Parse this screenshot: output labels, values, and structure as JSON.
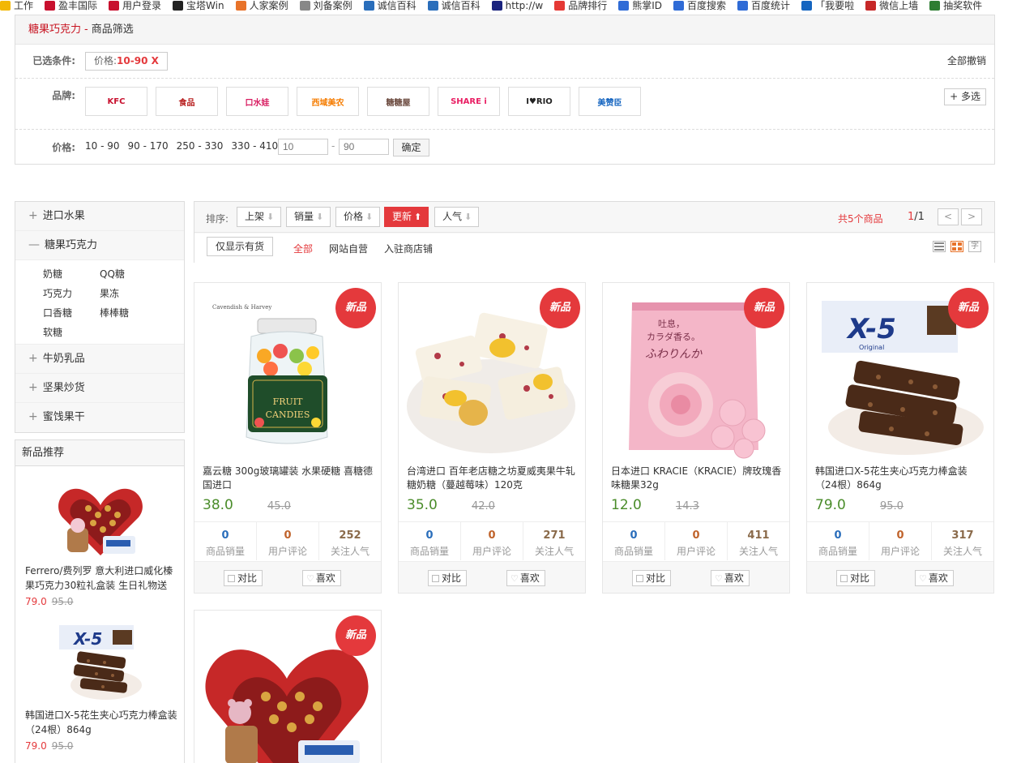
{
  "bookmarks": [
    {
      "label": "工作",
      "icon": "folder-icon",
      "color": "#f2b705"
    },
    {
      "label": "盈丰国际",
      "icon": "kfc-icon",
      "color": "#c8102e"
    },
    {
      "label": "用户登录",
      "icon": "kfc-icon",
      "color": "#c8102e"
    },
    {
      "label": "宝塔Win",
      "icon": "bt-icon",
      "color": "#222222"
    },
    {
      "label": "人家案例",
      "icon": "cart-icon",
      "color": "#e8732a"
    },
    {
      "label": "刘备案例",
      "icon": "page-icon",
      "color": "#888888"
    },
    {
      "label": "诚信百科",
      "icon": "wave-icon",
      "color": "#2a6ebb"
    },
    {
      "label": "诚信百科",
      "icon": "wave-icon",
      "color": "#2a6ebb"
    },
    {
      "label": "http://w",
      "icon": "star-icon",
      "color": "#1a237e"
    },
    {
      "label": "品牌排行",
      "icon": "star-icon",
      "color": "#e53935"
    },
    {
      "label": "熊掌ID",
      "icon": "paw-icon",
      "color": "#2f6bd6"
    },
    {
      "label": "百度搜索",
      "icon": "paw-icon",
      "color": "#2f6bd6"
    },
    {
      "label": "百度统计",
      "icon": "chart-icon",
      "color": "#2f6bd6"
    },
    {
      "label": "「我要啦",
      "icon": "arrow-icon",
      "color": "#1565c0"
    },
    {
      "label": "微信上墙",
      "icon": "gift-icon",
      "color": "#c62828"
    },
    {
      "label": "抽奖软件",
      "icon": "box-icon",
      "color": "#2e7d32"
    }
  ],
  "filter": {
    "category": "糖果巧克力",
    "separator": "-",
    "title": "商品筛选",
    "selected_label": "已选条件:",
    "selected_tag_key": "价格:",
    "selected_tag_value": "10-90 X",
    "clear_all": "全部撤销",
    "brand_label": "品牌:",
    "brands": [
      {
        "text": "KFC",
        "color": "#c8102e"
      },
      {
        "text": "食品",
        "color": "#b71c1c"
      },
      {
        "text": "口水娃",
        "color": "#d81b60"
      },
      {
        "text": "西域美农",
        "color": "#f57c00"
      },
      {
        "text": "糖糖屋",
        "color": "#6d4c41"
      },
      {
        "text": "SHARE i",
        "color": "#e91e63"
      },
      {
        "text": "I♥RIO",
        "color": "#222222"
      },
      {
        "text": "美赞臣",
        "color": "#1565c0"
      }
    ],
    "multi_select": "+ 多选",
    "price_label": "价格:",
    "price_ranges": [
      "10 - 90",
      "90 - 170",
      "250 - 330",
      "330 - 410"
    ],
    "price_min_placeholder": "10",
    "price_max_placeholder": "90",
    "price_dash": "-",
    "confirm": "确定"
  },
  "sidebar": {
    "categories": [
      {
        "sign": "+",
        "label": "进口水果"
      },
      {
        "sign": "—",
        "label": "糖果巧克力"
      }
    ],
    "subcategories": [
      "奶糖",
      "QQ糖",
      "巧克力",
      "果冻",
      "口香糖",
      "棒棒糖",
      "软糖"
    ],
    "categories_after": [
      {
        "sign": "+",
        "label": "牛奶乳品"
      },
      {
        "sign": "+",
        "label": "坚果炒货"
      },
      {
        "sign": "+",
        "label": "蜜饯果干"
      }
    ]
  },
  "new_rec": {
    "title": "新品推荐",
    "items": [
      {
        "name": "Ferrero/费列罗 意大利进口威化榛果巧克力30粒礼盒装 生日礼物送",
        "price": "79.0",
        "old_price": "95.0"
      },
      {
        "name": "韩国进口X-5花生夹心巧克力棒盒装（24根）864g",
        "price": "79.0",
        "old_price": "95.0"
      }
    ]
  },
  "toolbar": {
    "sort_label": "排序:",
    "sorts": [
      {
        "label": "上架",
        "arrow": "⬇"
      },
      {
        "label": "销量",
        "arrow": "⬇"
      },
      {
        "label": "价格",
        "arrow": "⬇"
      },
      {
        "label": "更新",
        "arrow": "⬆"
      },
      {
        "label": "人气",
        "arrow": "⬇"
      }
    ],
    "total": "共5个商品",
    "page_current": "1",
    "page_total": "/1",
    "prev": "<",
    "next": ">",
    "stock_only": "仅显示有货",
    "tabs": [
      "全部",
      "网站自营",
      "入驻商店铺"
    ]
  },
  "product_common": {
    "badge": "新品",
    "sales_label": "商品销量",
    "comments_label": "用户评论",
    "popularity_label": "关注人气",
    "compare": "对比",
    "like": "喜欢"
  },
  "products": [
    {
      "name": "嘉云糖 300g玻璃罐装 水果硬糖 喜糖德国进口",
      "price": "38.0",
      "old_price": "45.0",
      "sales": "0",
      "comments": "0",
      "popularity": "252"
    },
    {
      "name": "台湾进口 百年老店糖之坊夏威夷果牛轧糖奶糖（蔓越莓味）120克",
      "price": "35.0",
      "old_price": "42.0",
      "sales": "0",
      "comments": "0",
      "popularity": "271"
    },
    {
      "name": "日本进口 KRACIE（KRACIE）牌玫瑰香味糖果32g",
      "price": "12.0",
      "old_price": "14.3",
      "sales": "0",
      "comments": "0",
      "popularity": "411"
    },
    {
      "name": "韩国进口X-5花生夹心巧克力棒盒装（24根）864g",
      "price": "79.0",
      "old_price": "95.0",
      "sales": "0",
      "comments": "0",
      "popularity": "317"
    }
  ],
  "colors": {
    "accent": "#e4393c",
    "price_green": "#4a8c2a",
    "sales_blue": "#2a6ebb",
    "comments_orange": "#c0632b",
    "popularity_brown": "#8a6a4a"
  }
}
